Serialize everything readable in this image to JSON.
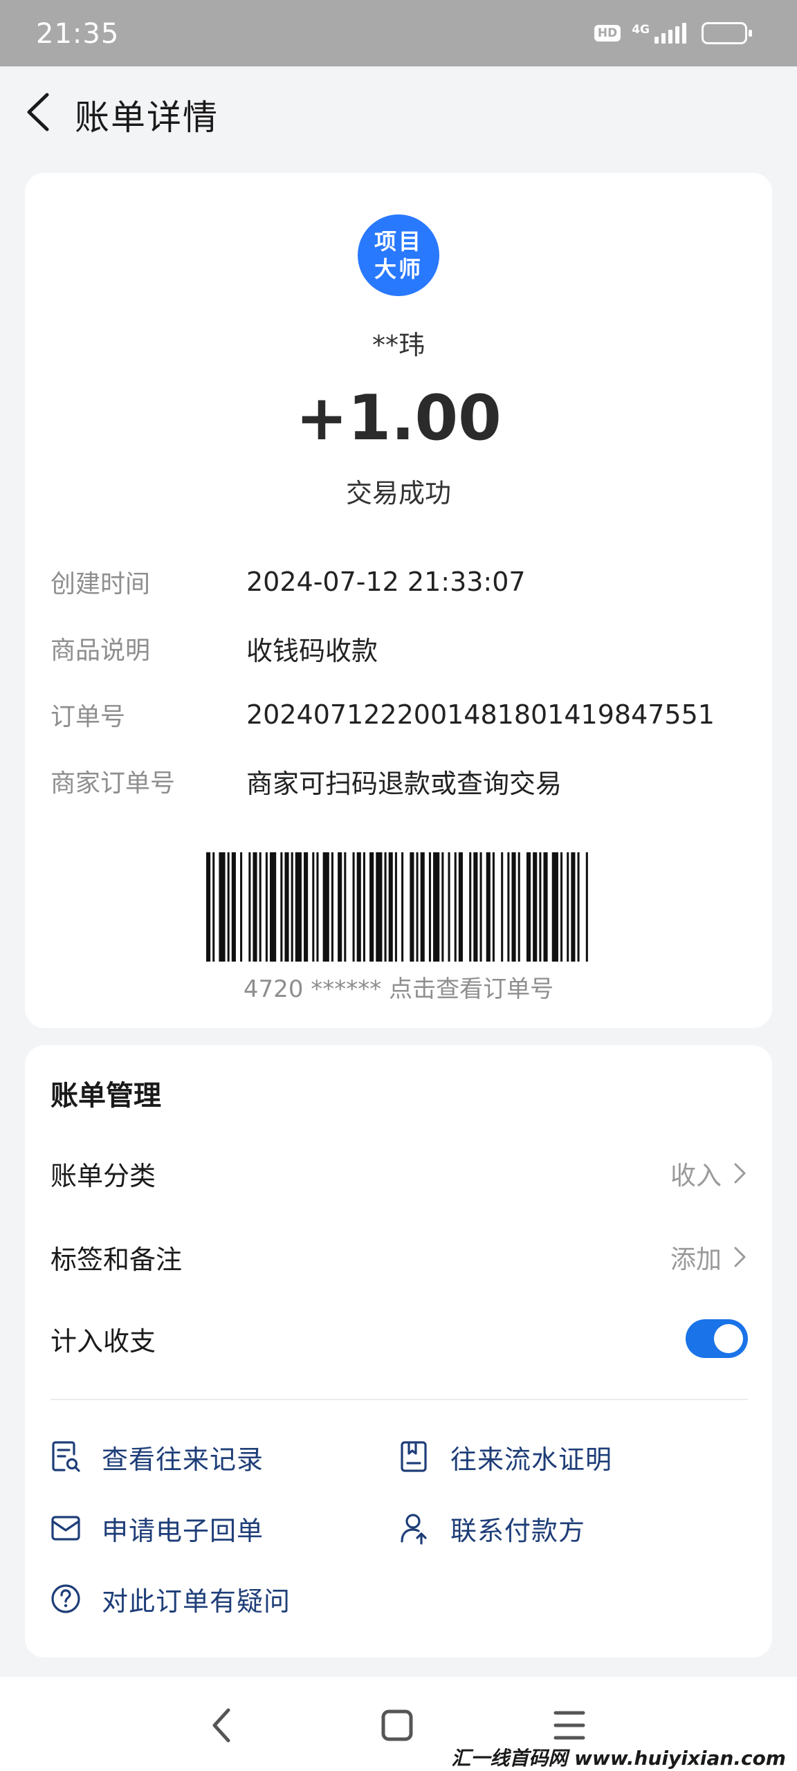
{
  "status_bar": {
    "time": "21:35",
    "hd": "HD",
    "network": "4G",
    "signal_bars": 5
  },
  "header": {
    "title": "账单详情"
  },
  "transaction": {
    "avatar_text": "项目大师",
    "payer": "**玮",
    "amount": "+1.00",
    "status": "交易成功"
  },
  "details": [
    {
      "label": "创建时间",
      "value": "2024-07-12 21:33:07"
    },
    {
      "label": "商品说明",
      "value": "收钱码收款"
    },
    {
      "label": "订单号",
      "value": "20240712220014818014198475​51"
    },
    {
      "label": "商家订单号",
      "value": "商家可扫码退款或查询交易"
    }
  ],
  "barcode": {
    "caption": "4720 ****** 点击查看订单号"
  },
  "management": {
    "title": "账单管理",
    "category": {
      "label": "账单分类",
      "value": "收入"
    },
    "tags": {
      "label": "标签和备注",
      "value": "添加"
    },
    "count_in_budget": {
      "label": "计入收支",
      "enabled": true
    }
  },
  "actions": [
    {
      "label": "查看往来记录",
      "icon": "records-search-icon"
    },
    {
      "label": "往来流水证明",
      "icon": "statement-proof-icon"
    },
    {
      "label": "申请电子回单",
      "icon": "envelope-icon"
    },
    {
      "label": "联系付款方",
      "icon": "contact-payer-icon"
    },
    {
      "label": "对此订单有疑问",
      "icon": "question-circle-icon"
    }
  ],
  "bottom_nav": [
    {
      "name": "back",
      "icon": "nav-back-icon"
    },
    {
      "name": "home",
      "icon": "nav-home-icon"
    },
    {
      "name": "menu",
      "icon": "nav-menu-icon"
    }
  ],
  "watermark": "汇一线首码网 www.huiyixian.com",
  "colors": {
    "accent": "#1a73e8",
    "avatar": "#2979ff",
    "action_text": "#1e3e78",
    "status_bar": "#a9a9a9"
  }
}
